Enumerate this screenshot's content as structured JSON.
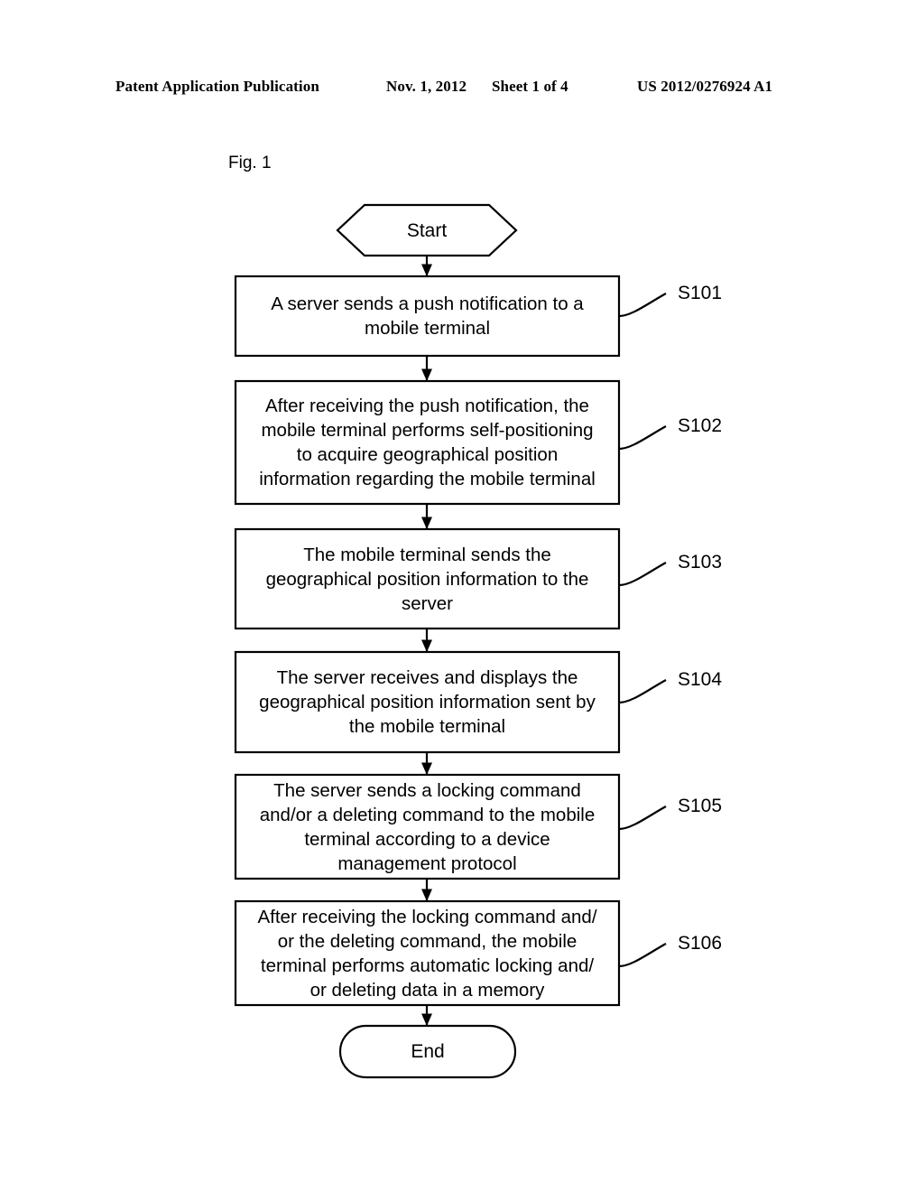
{
  "page_header": {
    "publication": "Patent Application Publication",
    "date": "Nov. 1, 2012",
    "sheet": "Sheet 1 of 4",
    "document_number": "US 2012/0276924 A1"
  },
  "figure": {
    "label": "Fig. 1",
    "type": "flowchart"
  },
  "flowchart": {
    "start_node": {
      "label": "Start",
      "shape": "hexagon"
    },
    "end_node": {
      "label": "End",
      "shape": "stadium"
    },
    "steps": [
      {
        "id": "S101",
        "ref": "S101",
        "text": "A server sends a push notification to a\nmobile terminal"
      },
      {
        "id": "S102",
        "ref": "S102",
        "text": "After receiving the push notification, the\nmobile terminal performs self-positioning\nto acquire geographical position\ninformation regarding the mobile terminal"
      },
      {
        "id": "S103",
        "ref": "S103",
        "text": "The mobile terminal sends the\ngeographical position information to the\nserver"
      },
      {
        "id": "S104",
        "ref": "S104",
        "text": "The server receives and displays the\ngeographical position information sent by\nthe mobile terminal"
      },
      {
        "id": "S105",
        "ref": "S105",
        "text": "The server sends a locking command\nand/or a deleting command to the mobile\nterminal according to a device\nmanagement protocol"
      },
      {
        "id": "S106",
        "ref": "S106",
        "text": "After receiving the locking command and/\nor the deleting command, the mobile\nterminal performs automatic locking and/\nor deleting data in a memory"
      }
    ],
    "colors": {
      "stroke": "#000000",
      "fill": "#ffffff",
      "background": "#ffffff"
    }
  }
}
